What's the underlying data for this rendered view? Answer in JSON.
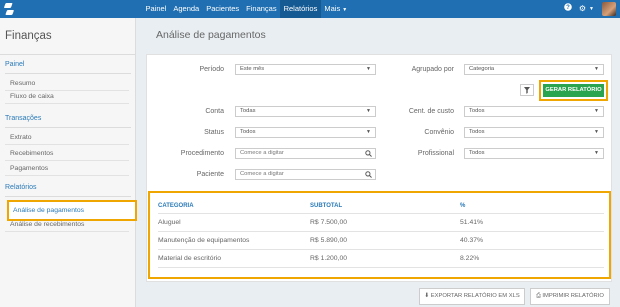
{
  "nav": {
    "items": [
      "Painel",
      "Agenda",
      "Pacientes",
      "Finanças",
      "Relatórios",
      "Mais"
    ],
    "active": "Relatórios",
    "icons": [
      "help-icon",
      "gear-icon",
      "avatar"
    ]
  },
  "sidebar": {
    "title": "Finanças",
    "sections": [
      {
        "label": "Painel",
        "items": [
          "Resumo",
          "Fluxo de caixa"
        ]
      },
      {
        "label": "Transações",
        "items": [
          "Extrato",
          "Recebimentos",
          "Pagamentos"
        ]
      },
      {
        "label": "Relatórios",
        "items": [
          "Análise de pagamentos",
          "Análise de recebimentos"
        ]
      }
    ],
    "active_item": "Análise de pagamentos"
  },
  "page_title": "Análise de pagamentos",
  "filters": {
    "periodo": {
      "label": "Período",
      "value": "Este mês"
    },
    "agrupado": {
      "label": "Agrupado por",
      "value": "Categoria"
    },
    "conta": {
      "label": "Conta",
      "value": "Todas"
    },
    "cent_custo": {
      "label": "Cent. de custo",
      "value": "Todos"
    },
    "status": {
      "label": "Status",
      "value": "Todos"
    },
    "convenio": {
      "label": "Convênio",
      "value": "Todos"
    },
    "procedimento": {
      "label": "Procedimento",
      "placeholder": "Comece a digitar"
    },
    "profissional": {
      "label": "Profissional",
      "value": "Todos"
    },
    "paciente": {
      "label": "Paciente",
      "placeholder": "Comece a digitar"
    }
  },
  "generate_button": "GERAR RELATÓRIO",
  "table": {
    "headers": [
      "CATEGORIA",
      "SUBTOTAL",
      "%"
    ],
    "rows": [
      {
        "categoria": "Aluguel",
        "subtotal": "R$ 7.500,00",
        "pct": "51.41%"
      },
      {
        "categoria": "Manutenção de equipamentos",
        "subtotal": "R$ 5.890,00",
        "pct": "40.37%"
      },
      {
        "categoria": "Material de escritório",
        "subtotal": "R$ 1.200,00",
        "pct": "8.22%"
      }
    ]
  },
  "footer": {
    "export_label": "EXPORTAR RELATÓRIO EM XLS",
    "print_label": "IMPRIMIR RELATÓRIO"
  },
  "colors": {
    "nav_bg": "#1f6fb2",
    "accent": "#2a7ab8",
    "highlight": "#f0a600",
    "generate": "#2aa44f"
  }
}
